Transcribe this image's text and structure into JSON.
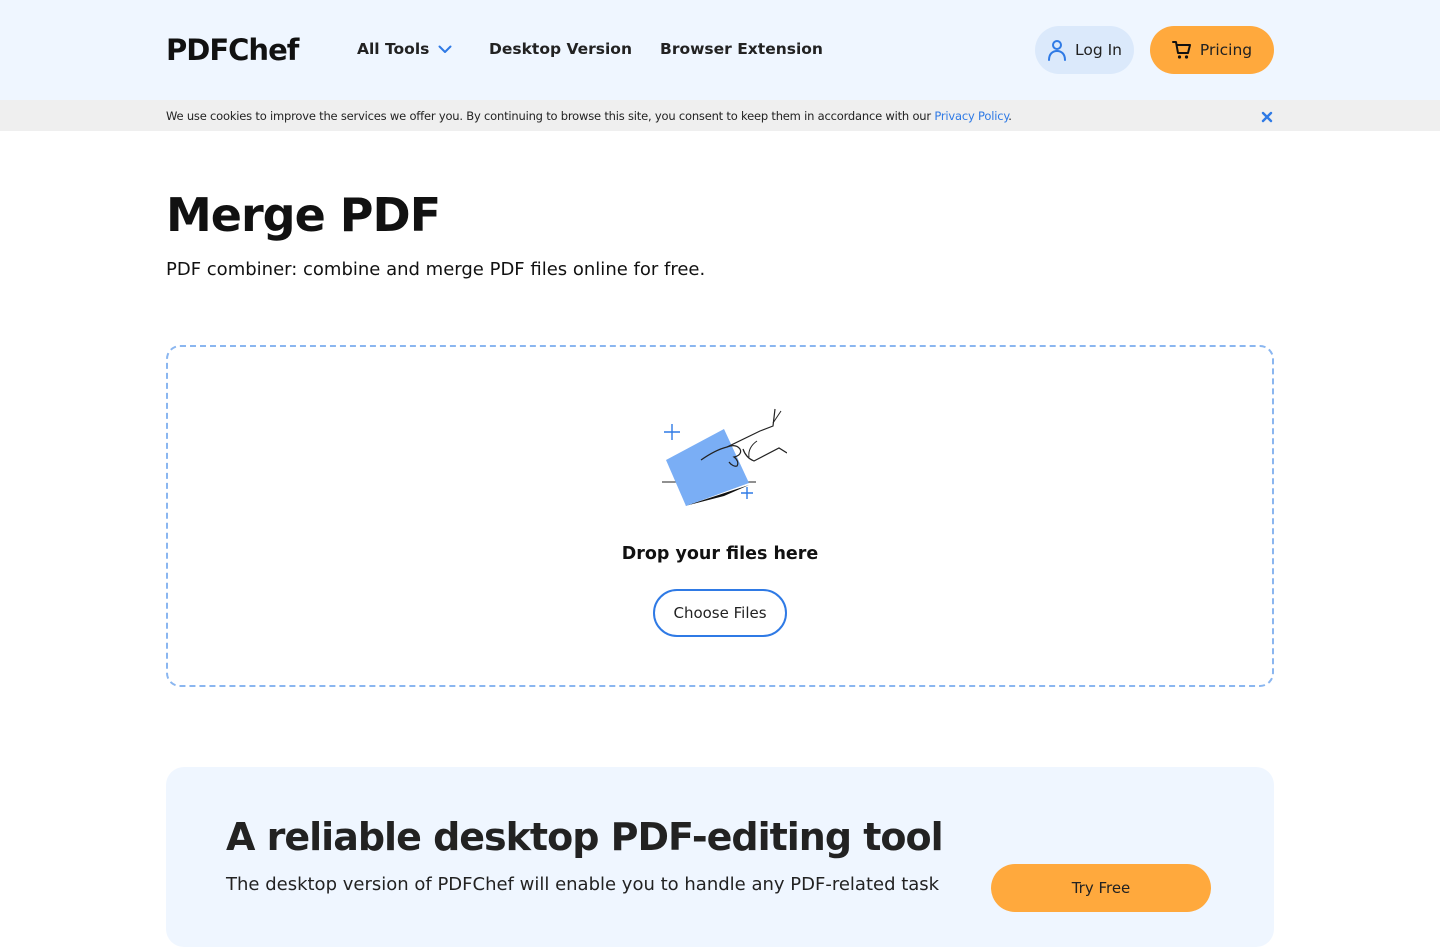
{
  "header": {
    "logo": "PDFChef",
    "nav": [
      {
        "label": "All Tools",
        "has_dropdown": true
      },
      {
        "label": "Desktop Version"
      },
      {
        "label": "Browser Extension"
      }
    ],
    "login_label": "Log In",
    "pricing_label": "Pricing"
  },
  "cookie_bar": {
    "text": "We use cookies to improve the services we offer you. By continuing to browse this site, you consent to keep them in accordance with our ",
    "link_text": "Privacy Policy",
    "suffix": "."
  },
  "main": {
    "title": "Merge PDF",
    "subtitle": "PDF combiner: combine and merge PDF files online for free."
  },
  "dropzone": {
    "drop_text": "Drop your files here",
    "choose_label": "Choose Files"
  },
  "promo": {
    "title": "A reliable desktop PDF-editing tool",
    "text": "The desktop version of PDFChef will enable you to handle any PDF-related task",
    "try_label": "Try Free"
  },
  "colors": {
    "accent_blue": "#2f7ae5",
    "accent_orange": "#ffa93d",
    "header_bg": "#eff6ff",
    "cookie_bg": "#efefef"
  },
  "icons": [
    "chevron-down-icon",
    "user-icon",
    "cart-icon",
    "close-icon",
    "drop-files-illustration"
  ]
}
